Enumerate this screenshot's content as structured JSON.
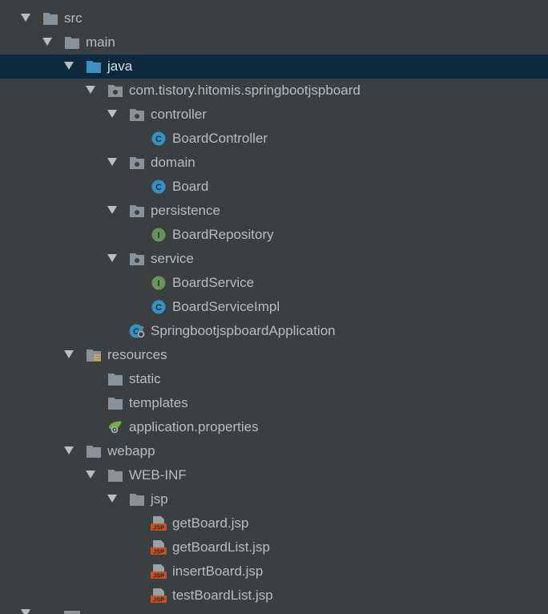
{
  "tree": {
    "nodes": [
      {
        "label": "src",
        "depth": 0,
        "expanded": true,
        "icon": "folder-icon"
      },
      {
        "label": "main",
        "depth": 1,
        "expanded": true,
        "icon": "folder-icon"
      },
      {
        "label": "java",
        "depth": 2,
        "expanded": true,
        "icon": "source-folder-icon",
        "selected": true
      },
      {
        "label": "com.tistory.hitomis.springbootjspboard",
        "depth": 3,
        "expanded": true,
        "icon": "package-icon"
      },
      {
        "label": "controller",
        "depth": 4,
        "expanded": true,
        "icon": "package-icon"
      },
      {
        "label": "BoardController",
        "depth": 5,
        "icon": "class-icon"
      },
      {
        "label": "domain",
        "depth": 4,
        "expanded": true,
        "icon": "package-icon"
      },
      {
        "label": "Board",
        "depth": 5,
        "icon": "class-icon"
      },
      {
        "label": "persistence",
        "depth": 4,
        "expanded": true,
        "icon": "package-icon"
      },
      {
        "label": "BoardRepository",
        "depth": 5,
        "icon": "interface-icon"
      },
      {
        "label": "service",
        "depth": 4,
        "expanded": true,
        "icon": "package-icon"
      },
      {
        "label": "BoardService",
        "depth": 5,
        "icon": "interface-icon"
      },
      {
        "label": "BoardServiceImpl",
        "depth": 5,
        "icon": "class-icon"
      },
      {
        "label": "SpringbootjspboardApplication",
        "depth": 4,
        "icon": "spring-boot-class-icon"
      },
      {
        "label": "resources",
        "depth": 2,
        "expanded": true,
        "icon": "resources-folder-icon"
      },
      {
        "label": "static",
        "depth": 3,
        "icon": "folder-icon"
      },
      {
        "label": "templates",
        "depth": 3,
        "icon": "folder-icon"
      },
      {
        "label": "application.properties",
        "depth": 3,
        "icon": "spring-properties-icon"
      },
      {
        "label": "webapp",
        "depth": 2,
        "expanded": true,
        "icon": "folder-icon"
      },
      {
        "label": "WEB-INF",
        "depth": 3,
        "expanded": true,
        "icon": "folder-icon"
      },
      {
        "label": "jsp",
        "depth": 4,
        "expanded": true,
        "icon": "folder-icon"
      },
      {
        "label": "getBoard.jsp",
        "depth": 5,
        "icon": "jsp-file-icon"
      },
      {
        "label": "getBoardList.jsp",
        "depth": 5,
        "icon": "jsp-file-icon"
      },
      {
        "label": "insertBoard.jsp",
        "depth": 5,
        "icon": "jsp-file-icon"
      },
      {
        "label": "testBoardList.jsp",
        "depth": 5,
        "icon": "jsp-file-icon"
      }
    ]
  },
  "colors": {
    "background": "#3c3f41",
    "selection": "#0d293e",
    "text": "#bbbbbb",
    "folder": "#8a9299",
    "source_folder": "#3d8fc6",
    "class_badge": "#3592c4",
    "interface_badge": "#629755",
    "jsp": "#c75025",
    "spring": "#6db33f"
  },
  "badges": {
    "class": "C",
    "interface": "I",
    "jsp": "JSP"
  }
}
